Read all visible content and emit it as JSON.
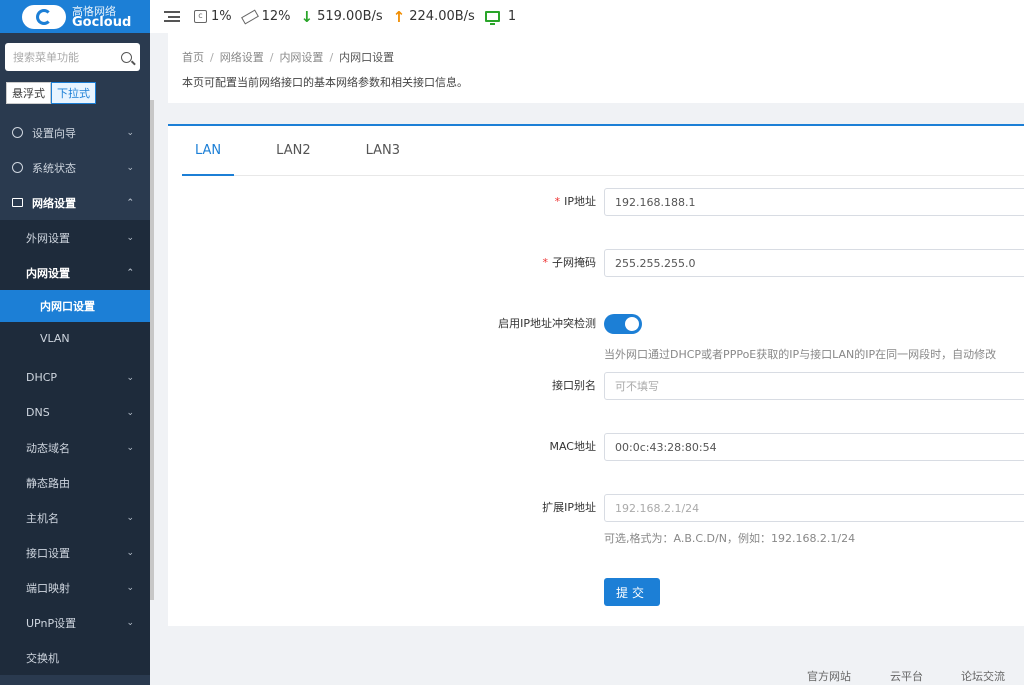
{
  "logo": {
    "cn": "高恪网络",
    "en": "Gocloud"
  },
  "sidebar": {
    "search_placeholder": "搜索菜单功能",
    "modes": [
      "悬浮式",
      "下拉式"
    ],
    "menu": {
      "setup_wizard": "设置向导",
      "system_status": "系统状态",
      "network_settings": "网络设置",
      "wan_settings": "外网设置",
      "lan_settings": "内网设置",
      "lan_port_settings": "内网口设置",
      "vlan": "VLAN",
      "dhcp": "DHCP",
      "dns": "DNS",
      "ddns": "动态域名",
      "static_route": "静态路由",
      "hostname": "主机名",
      "interface_settings": "接口设置",
      "port_mapping": "端口映射",
      "upnp": "UPnP设置",
      "switch": "交换机"
    }
  },
  "topbar": {
    "cpu": "1%",
    "memory": "12%",
    "download": "519.00B/s",
    "upload": "224.00B/s",
    "devices": "1"
  },
  "header": {
    "breadcrumb": [
      "首页",
      "网络设置",
      "内网设置",
      "内网口设置"
    ],
    "description": "本页可配置当前网络接口的基本网络参数和相关接口信息。"
  },
  "tabs": [
    "LAN",
    "LAN2",
    "LAN3"
  ],
  "form": {
    "ip_label": "IP地址",
    "ip_value": "192.168.188.1",
    "mask_label": "子网掩码",
    "mask_value": "255.255.255.0",
    "conflict_label": "启用IP地址冲突检测",
    "conflict_hint": "当外网口通过DHCP或者PPPoE获取的IP与接口LAN的IP在同一网段时，自动修改",
    "alias_label": "接口别名",
    "alias_placeholder": "可不填写",
    "mac_label": "MAC地址",
    "mac_value": "00:0c:43:28:80:54",
    "ext_ip_label": "扩展IP地址",
    "ext_ip_placeholder": "192.168.2.1/24",
    "ext_ip_hint": "可选,格式为：A.B.C.D/N，例如：192.168.2.1/24",
    "submit": "提交"
  },
  "footer": [
    "官方网站",
    "云平台",
    "论坛交流"
  ],
  "colors": {
    "accent": "#1c7fd6",
    "sidebar": "#2a3a4f",
    "upload": "#f08c00",
    "download": "#2aa52a"
  }
}
